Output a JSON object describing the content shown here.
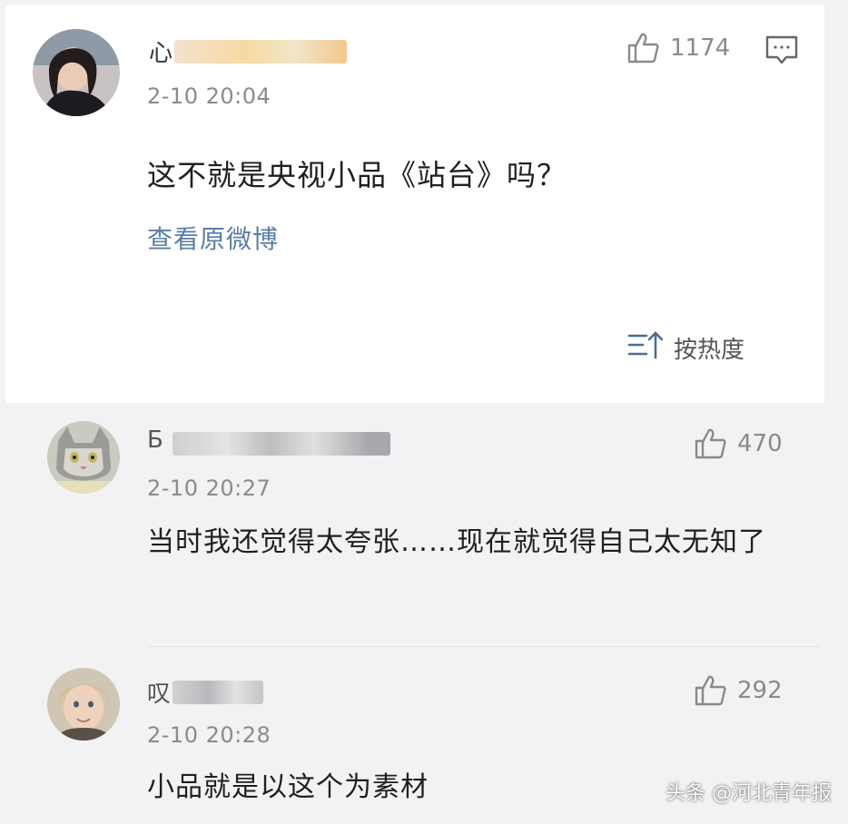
{
  "post": {
    "username_prefix": "心",
    "time": "2-10 20:04",
    "likes": "1174",
    "text": "这不就是央视小品《站台》吗？",
    "view_original": "查看原微博",
    "sort_label": "按热度"
  },
  "comments": [
    {
      "username_prefix": "Б",
      "time": "2-10 20:27",
      "likes": "470",
      "text": "当时我还觉得太夸张……现在就觉得自己太无知了"
    },
    {
      "username_prefix": "叹",
      "time": "2-10 20:28",
      "likes": "292",
      "text": "小品就是以这个为素材"
    }
  ],
  "watermark": "头条 @河北青年报",
  "colors": {
    "link": "#5b7da6",
    "muted": "#8b8b8b",
    "card": "#ffffff",
    "background": "#f2f2f4"
  },
  "icons": [
    "thumbs-up-icon",
    "comment-bubble-icon",
    "sort-icon"
  ]
}
